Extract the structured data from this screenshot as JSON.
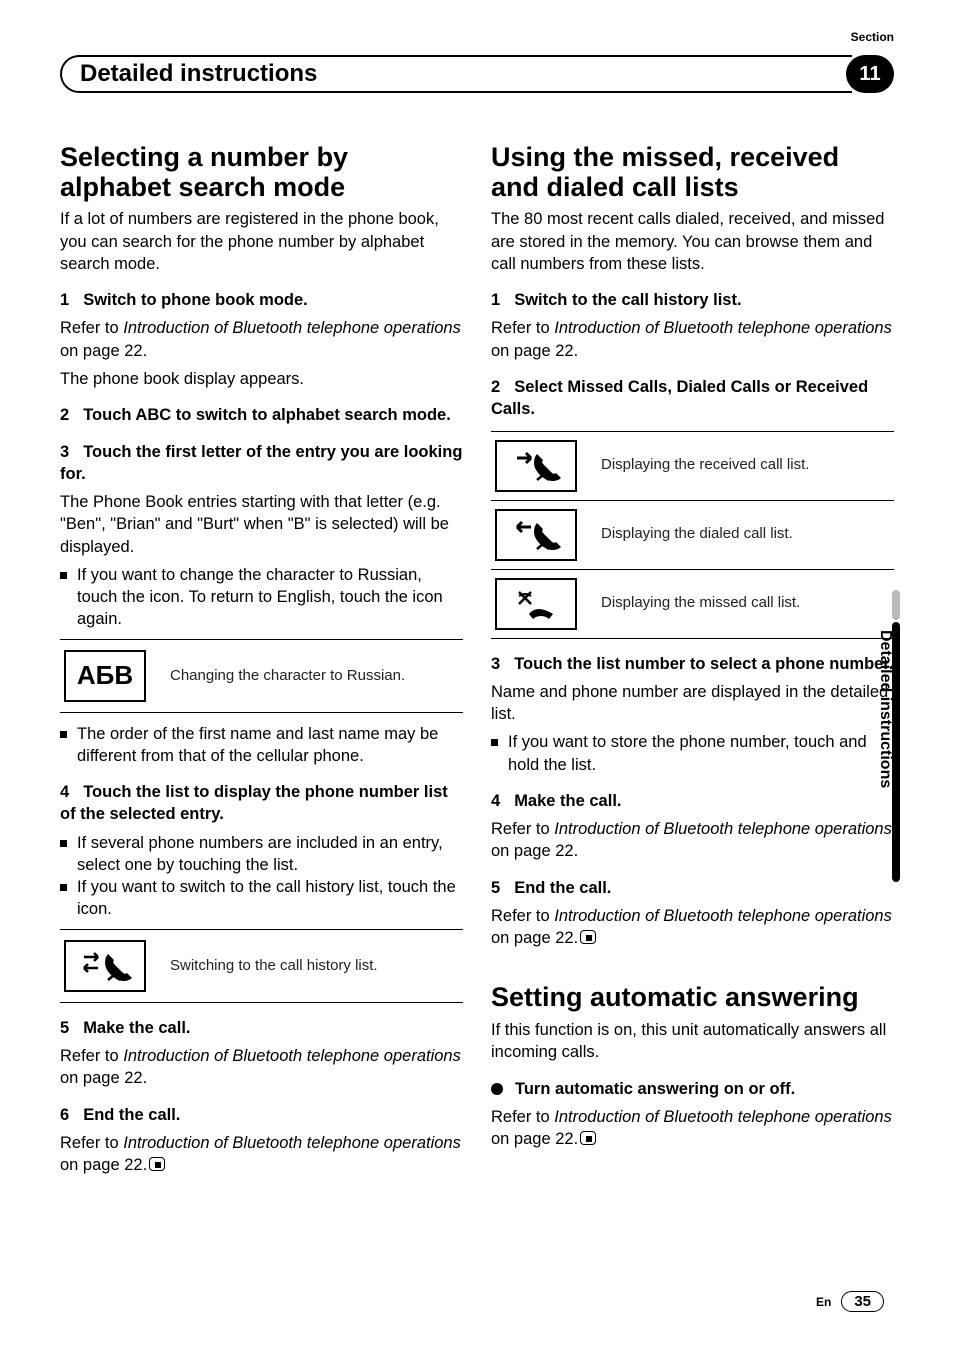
{
  "header": {
    "section_label": "Section",
    "title": "Detailed instructions",
    "section_number": "11"
  },
  "side_tab": {
    "label": "Detailed instructions"
  },
  "footer": {
    "lang": "En",
    "page": "35"
  },
  "left": {
    "h2": "Selecting a number by alphabet search mode",
    "intro": "If a lot of numbers are registered in the phone book, you can search for the phone number by alphabet search mode.",
    "s1_head_num": "1",
    "s1_head": "Switch to phone book mode.",
    "s1_refer_a": "Refer to ",
    "s1_refer_i": "Introduction of Bluetooth telephone operations",
    "s1_refer_b": " on page 22.",
    "s1_body": "The phone book display appears.",
    "s2_head_num": "2",
    "s2_head": "Touch ABC to switch to alphabet search mode.",
    "s3_head_num": "3",
    "s3_head": "Touch the first letter of the entry you are looking for.",
    "s3_body": "The Phone Book entries starting with that letter (e.g. \"Ben\", \"Brian\" and \"Burt\" when \"B\" is selected) will be displayed.",
    "s3_bullet": "If you want to change the character to Russian, touch the icon. To return to English, touch the icon again.",
    "icon_rus_label": "АБВ",
    "icon_rus_desc": "Changing the character to Russian.",
    "s3_bullet2": "The order of the first name and last name may be different from that of the cellular phone.",
    "s4_head_num": "4",
    "s4_head": "Touch the list to display the phone number list of the selected entry.",
    "s4_bullet1": "If several phone numbers are included in an entry, select one by touching the list.",
    "s4_bullet2": "If you want to switch to the call history list, touch the icon.",
    "icon_hist_desc": "Switching to the call history list.",
    "s5_head_num": "5",
    "s5_head": "Make the call.",
    "s5_refer_a": "Refer to ",
    "s5_refer_i": "Introduction of Bluetooth telephone operations",
    "s5_refer_b": " on page 22.",
    "s6_head_num": "6",
    "s6_head": "End the call.",
    "s6_refer_a": "Refer to ",
    "s6_refer_i": "Introduction of Bluetooth telephone operations",
    "s6_refer_b": " on page 22."
  },
  "right": {
    "h2a": "Using the missed, received and dialed call lists",
    "intro": "The 80 most recent calls dialed, received, and missed are stored in the memory. You can browse them and call numbers from these lists.",
    "s1_head_num": "1",
    "s1_head": "Switch to the call history list.",
    "s1_refer_a": "Refer to ",
    "s1_refer_i": "Introduction of Bluetooth telephone operations",
    "s1_refer_b": " on page 22.",
    "s2_head_num": "2",
    "s2_head": "Select Missed Calls, Dialed Calls or Received Calls.",
    "row_received": "Displaying the received call list.",
    "row_dialed": "Displaying the dialed call list.",
    "row_missed": "Displaying the missed call list.",
    "s3_head_num": "3",
    "s3_head": "Touch the list number to select a phone number.",
    "s3_body": "Name and phone number are displayed in the detailed list.",
    "s3_bullet": "If you want to store the phone number, touch and hold the list.",
    "s4_head_num": "4",
    "s4_head": "Make the call.",
    "s4_refer_a": "Refer to ",
    "s4_refer_i": "Introduction of Bluetooth telephone operations",
    "s4_refer_b": " on page 22.",
    "s5_head_num": "5",
    "s5_head": "End the call.",
    "s5_refer_a": "Refer to ",
    "s5_refer_i": "Introduction of Bluetooth telephone operations",
    "s5_refer_b": " on page 22.",
    "h2b": "Setting automatic answering",
    "auto_intro": "If this function is on, this unit automatically answers all incoming calls.",
    "auto_head": "Turn automatic answering on or off.",
    "auto_refer_a": "Refer to ",
    "auto_refer_i": "Introduction of Bluetooth telephone operations",
    "auto_refer_b": " on page 22."
  }
}
